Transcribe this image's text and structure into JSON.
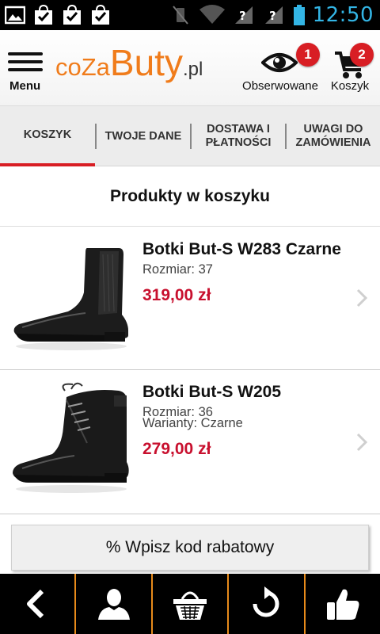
{
  "statusbar": {
    "time": "12:50"
  },
  "header": {
    "menu_label": "Menu",
    "logo": {
      "part1": "coZa",
      "part2": "Buty",
      "part3": ".pl"
    },
    "watch_label": "Obserwowane",
    "watch_count": "1",
    "cart_label": "Koszyk",
    "cart_count": "2"
  },
  "tabs": [
    {
      "label": "KOSZYK",
      "active": true
    },
    {
      "label": "TWOJE DANE",
      "active": false
    },
    {
      "label": "DOSTAWA I\nPŁATNOŚCI",
      "active": false
    },
    {
      "label": "UWAGI DO\nZAMÓWIENIA",
      "active": false
    }
  ],
  "section_title": "Produkty w koszyku",
  "products": [
    {
      "name": "Botki But-S W283 Czarne",
      "size": "Rozmiar: 37",
      "price": "319,00 zł"
    },
    {
      "name": "Botki But-S W205",
      "size": "Rozmiar: 36",
      "variant": "Warianty: Czarne",
      "price": "279,00 zł"
    }
  ],
  "discount_label": "% Wpisz kod rabatowy",
  "colors": {
    "accent": "#d81e24",
    "price": "#c8102e",
    "brand": "#f07c1b",
    "nav_divider": "#e88a1a",
    "status_time": "#33b5e5"
  },
  "bottom_nav": [
    {
      "icon": "back-arrow-icon"
    },
    {
      "icon": "user-icon"
    },
    {
      "icon": "basket-icon"
    },
    {
      "icon": "refresh-icon"
    },
    {
      "icon": "thumbs-up-icon"
    }
  ]
}
